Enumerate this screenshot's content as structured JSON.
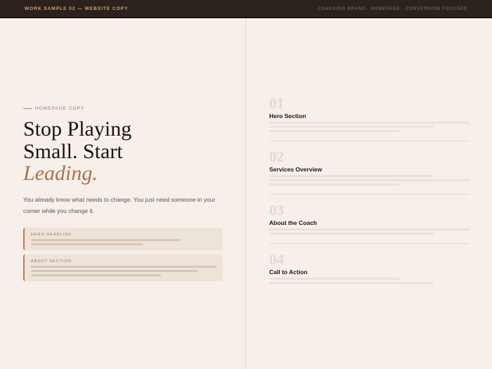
{
  "topbar": {
    "left_label": "WORK SAMPLE 02 — WEBSITE COPY",
    "right_label": "COACHING BRAND · HOMEPAGE · CONVERSION FOCUSED"
  },
  "hero": {
    "eyebrow": "HOMEPAGE COPY",
    "headline_line1": "Stop Playing",
    "headline_line2": "Small. Start",
    "headline_accent": "Leading.",
    "intro": "You already know what needs to change. You just need someone in your corner while you change it."
  },
  "cards": [
    {
      "label": "HERO HEADLINE"
    },
    {
      "label": "ABOUT SECTION"
    }
  ],
  "sections": [
    {
      "number": "01",
      "title": "Hero Section"
    },
    {
      "number": "02",
      "title": "Services Overview"
    },
    {
      "number": "03",
      "title": "About the Coach"
    },
    {
      "number": "04",
      "title": "Call to Action"
    }
  ],
  "colors": {
    "background": "#f6efea",
    "topbar": "#2b221d",
    "accent": "#b06f48",
    "gold": "#d3a872"
  }
}
